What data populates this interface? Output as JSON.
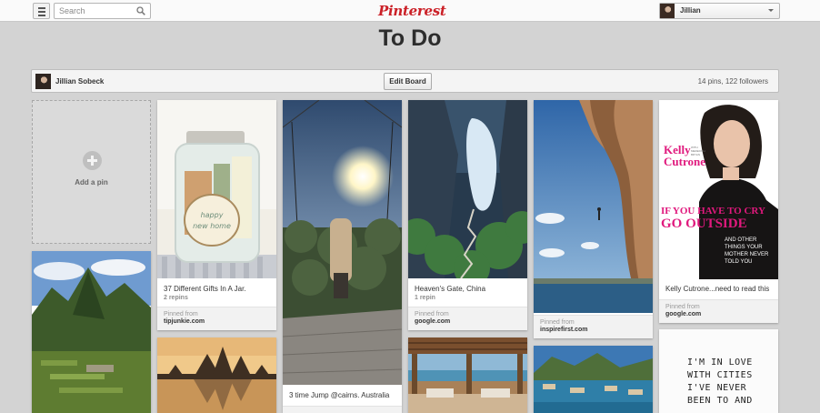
{
  "topbar": {
    "search_placeholder": "Search",
    "logo": "Pinterest",
    "user_name": "Jillian"
  },
  "board": {
    "title": "To Do",
    "owner": "Jillian Sobeck",
    "edit_label": "Edit Board",
    "stats": "14 pins, 122 followers",
    "add_pin_label": "Add a pin"
  },
  "pins": [
    {
      "description": "37 Different Gifts In A Jar.",
      "repins": "2 repins",
      "pinned_from_label": "Pinned from",
      "source": "tipjunkie.com"
    },
    {
      "description": "3 time Jump @cairns. Australia"
    },
    {
      "description": "Heaven's Gate, China",
      "repins": "1 repin",
      "pinned_from_label": "Pinned from",
      "source": "google.com"
    },
    {
      "pinned_from_label": "Pinned from",
      "source": "inspirefirst.com"
    },
    {
      "description": "Kelly Cutrone...need to read this",
      "pinned_from_label": "Pinned from",
      "source": "google.com"
    }
  ],
  "book_cover": {
    "author_line1": "Kelly",
    "author_line2": "Cutrone",
    "author_small": "WITH MEREDITH BRYAN",
    "title_line1": "IF YOU HAVE TO CRY",
    "title_line2": "GO OUTSIDE",
    "subtitle_line1": "AND OTHER",
    "subtitle_line2": "THINGS YOUR",
    "subtitle_line3": "MOTHER NEVER",
    "subtitle_line4": "TOLD YOU"
  },
  "quote_card": {
    "line1": "I'M IN LOVE",
    "line2": "WITH CITIES",
    "line3": "I'VE NEVER",
    "line4": "BEEN TO AND"
  },
  "icons": {
    "menu": "menu-icon",
    "search": "search-icon",
    "add": "plus-icon",
    "dropdown": "chevron-down-icon"
  },
  "colors": {
    "brand": "#cb2027",
    "background": "#d3d3d3",
    "book_title": "#e0197d"
  }
}
